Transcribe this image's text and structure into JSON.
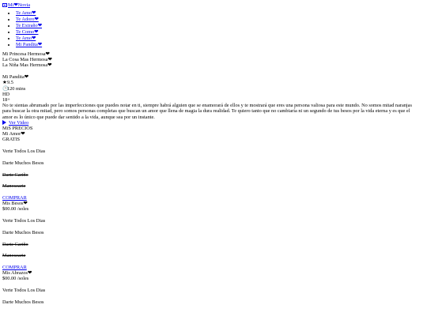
{
  "brand": {
    "name": "Mi❤Novia",
    "icon": "logo-icon"
  },
  "nav": {
    "items": [
      {
        "label": "Te Amo❤"
      },
      {
        "label": "Te Adoro❤"
      },
      {
        "label": "Te Extraño❤"
      },
      {
        "label": "Te Como❤"
      },
      {
        "label": "Te Amo❤"
      },
      {
        "label": "Mi Pandita❤"
      }
    ]
  },
  "hero": {
    "lines": [
      "Mi Princesa Hermosa❤",
      "La Cosa Mas Hermosa❤",
      "La Niña Mas Hermosa❤"
    ]
  },
  "movie": {
    "title": "Mi Pandita❤",
    "rating": "9.5",
    "rating_icon": "star-icon",
    "duration": "120 mins",
    "duration_icon": "clock-icon",
    "quality": "HD",
    "age": "18+",
    "description": "No te sientas abrumado por las imperfecciones que puedes notar en ti, siempre habrá alguien que se enamorará de ellos y te mostrará que eres una persona valiosa para este mundo. No somos mitad naranjas para buscar la otra mitad, pero somos personas completas que buscan un amor que llena de magia la dura realidad. Te quiero tanto que no cambiaría ni un segundo de tus besos por la vida eterna y es que el amor es lo único que puede dar sentido a la vida, aunque sea por un instante.",
    "video_link": "Ver Video",
    "video_icon": "play-icon"
  },
  "pricing": {
    "heading": "MiS PRECIOS",
    "plans": [
      {
        "name": "Mi Amor❤",
        "price": "GRATIS",
        "features": [
          {
            "text": "Verte Todos Los Dias",
            "included": true
          },
          {
            "text": "Darte Muchos Besos",
            "included": true
          },
          {
            "text": "Darte Cariño",
            "included": false
          },
          {
            "text": "Manosearte",
            "included": false
          }
        ],
        "cta": "COMPRAR"
      },
      {
        "name": "Mis Besos❤",
        "price": "$00.00 /soles",
        "features": [
          {
            "text": "Verte Todos Los Dias",
            "included": true
          },
          {
            "text": "Darte Muchos Besos",
            "included": true
          },
          {
            "text": "Darte Cariño",
            "included": false
          },
          {
            "text": "Manosearte",
            "included": false
          }
        ],
        "cta": "COMPRAR"
      },
      {
        "name": "Mis Abrazos❤",
        "price": "$00.00 /soles",
        "features": [
          {
            "text": "Verte Todos Los Dias",
            "included": true
          },
          {
            "text": "Darte Muchos Besos",
            "included": true
          }
        ]
      }
    ]
  },
  "colors": {
    "link": "#0000ee",
    "text": "#000000",
    "background": "#ffffff"
  }
}
